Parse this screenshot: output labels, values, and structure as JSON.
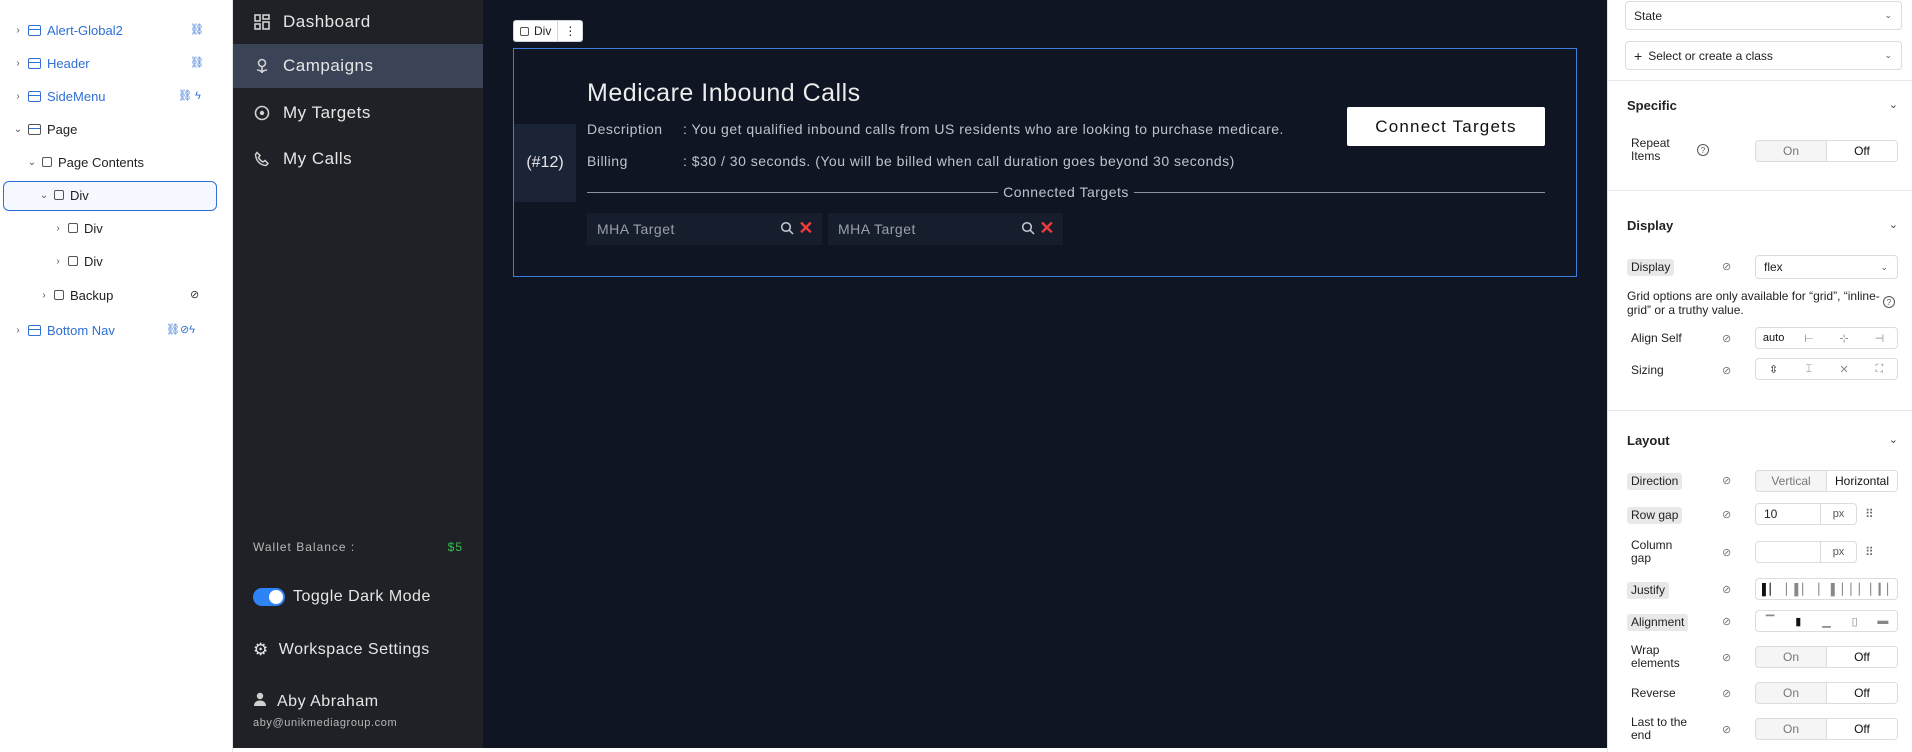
{
  "tree": {
    "items": [
      {
        "label": "Alert-Global2",
        "tail": "⛓"
      },
      {
        "label": "Header",
        "tail": "⛓"
      },
      {
        "label": "SideMenu",
        "tail": "⛓ ϟ"
      },
      {
        "label": "Page",
        "tail": ""
      },
      {
        "label": "Page Contents",
        "tail": ""
      },
      {
        "label": "Div",
        "tail": ""
      },
      {
        "label": "Div",
        "tail": ""
      },
      {
        "label": "Div",
        "tail": ""
      },
      {
        "label": "Backup",
        "tail": "⊘"
      },
      {
        "label": "Bottom Nav",
        "tail": "⛓⊘ϟ"
      }
    ]
  },
  "nav": {
    "items": [
      {
        "label": "Dashboard",
        "icon": "dashboard-icon"
      },
      {
        "label": "Campaigns",
        "icon": "campaigns-icon"
      },
      {
        "label": "My Targets",
        "icon": "target-icon"
      },
      {
        "label": "My Calls",
        "icon": "phone-icon"
      }
    ],
    "wallet_label": "Wallet Balance :",
    "wallet_amount": "$5",
    "toggle_label": "Toggle Dark Mode",
    "settings_label": "Workspace Settings",
    "user_name": "Aby Abraham",
    "user_email": "aby@unikmediagroup.com"
  },
  "canvas": {
    "chip_label": "Div",
    "chip_menu": "⋮",
    "campaign_id": "(#12)",
    "title": "Medicare Inbound Calls",
    "description_key": "Description",
    "description_val": ": You get qualified inbound calls from US residents who are looking to purchase medicare.",
    "billing_key": "Billing",
    "billing_val": ": $30 / 30 seconds. (You will be billed when call duration goes beyond 30 seconds)",
    "connect_button": "Connect Targets",
    "connected_label": "Connected Targets",
    "targets": [
      "MHA Target",
      "MHA Target"
    ]
  },
  "inspector": {
    "state_label": "State",
    "class_label": "Select or create a class",
    "specific_title": "Specific",
    "repeat_label": "Repeat Items",
    "on": "On",
    "off": "Off",
    "display_title": "Display",
    "display_label": "Display",
    "display_value": "flex",
    "grid_note": "Grid options are only available for “grid”, “inline-grid” or a truthy value.",
    "align_self_label": "Align Self",
    "align_self_value": "auto",
    "sizing_label": "Sizing",
    "layout_title": "Layout",
    "direction_label": "Direction",
    "direction_vertical": "Vertical",
    "direction_horizontal": "Horizontal",
    "row_gap_label": "Row gap",
    "row_gap_value": "10",
    "unit": "px",
    "column_gap_label": "Column gap",
    "column_gap_value": "",
    "justify_label": "Justify",
    "alignment_label": "Alignment",
    "wrap_label": "Wrap elements",
    "reverse_label": "Reverse",
    "last_label": "Last to the end"
  }
}
